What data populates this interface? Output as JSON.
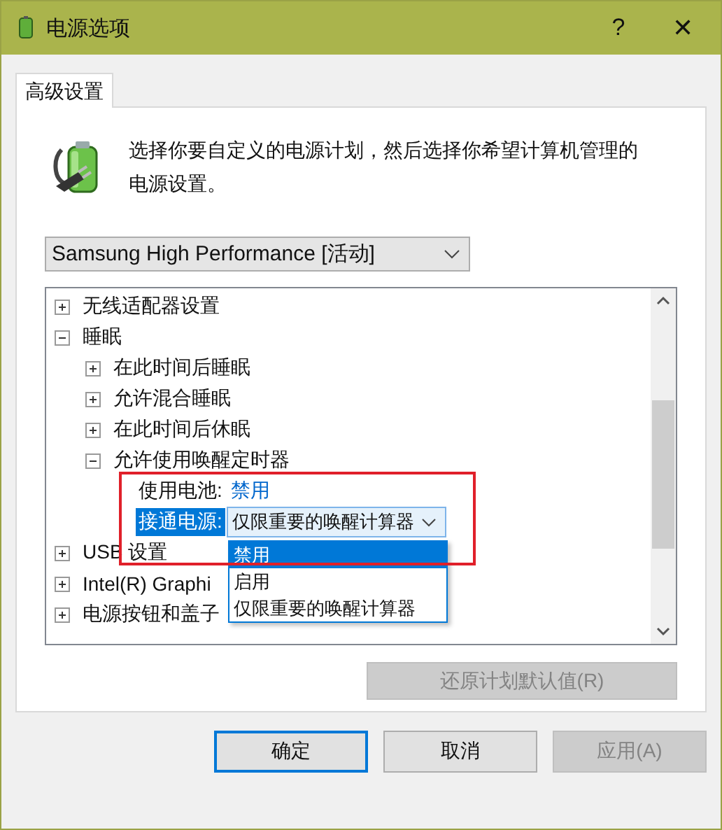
{
  "window": {
    "title": "电源选项",
    "help": "?",
    "close": "✕"
  },
  "tabs": [
    {
      "label": "高级设置",
      "selected": true
    }
  ],
  "description": "选择你要自定义的电源计划，然后选择你希望计算机管理的电源设置。",
  "plan": {
    "value": "Samsung High Performance [活动]"
  },
  "tree": [
    {
      "label": "无线适配器设置",
      "expanded": false
    },
    {
      "label": "睡眠",
      "expanded": true,
      "children": [
        {
          "label": "在此时间后睡眠",
          "expanded": false
        },
        {
          "label": "允许混合睡眠",
          "expanded": false
        },
        {
          "label": "在此时间后休眠",
          "expanded": false
        },
        {
          "label": "允许使用唤醒定时器",
          "expanded": true,
          "settings": [
            {
              "kind": "link",
              "label": "使用电池:",
              "value": "禁用",
              "selected": false
            },
            {
              "kind": "combo",
              "label": "接通电源:",
              "value": "仅限重要的唤醒计算器",
              "selected": true
            }
          ]
        }
      ]
    },
    {
      "label": "USB 设置",
      "expanded": false
    },
    {
      "label": "Intel(R) Graphi",
      "expanded": false
    },
    {
      "label": "电源按钮和盖子",
      "expanded": false
    }
  ],
  "dropdown_options": [
    {
      "label": "禁用",
      "selected": true
    },
    {
      "label": "启用",
      "selected": false
    },
    {
      "label": "仅限重要的唤醒计算器",
      "selected": false
    }
  ],
  "restore_button": {
    "label": "还原计划默认值(R)",
    "disabled": true
  },
  "buttons": [
    {
      "label": "确定",
      "focused": true,
      "disabled": false
    },
    {
      "label": "取消",
      "focused": false,
      "disabled": false
    },
    {
      "label": "应用(A)",
      "focused": false,
      "disabled": true
    }
  ]
}
